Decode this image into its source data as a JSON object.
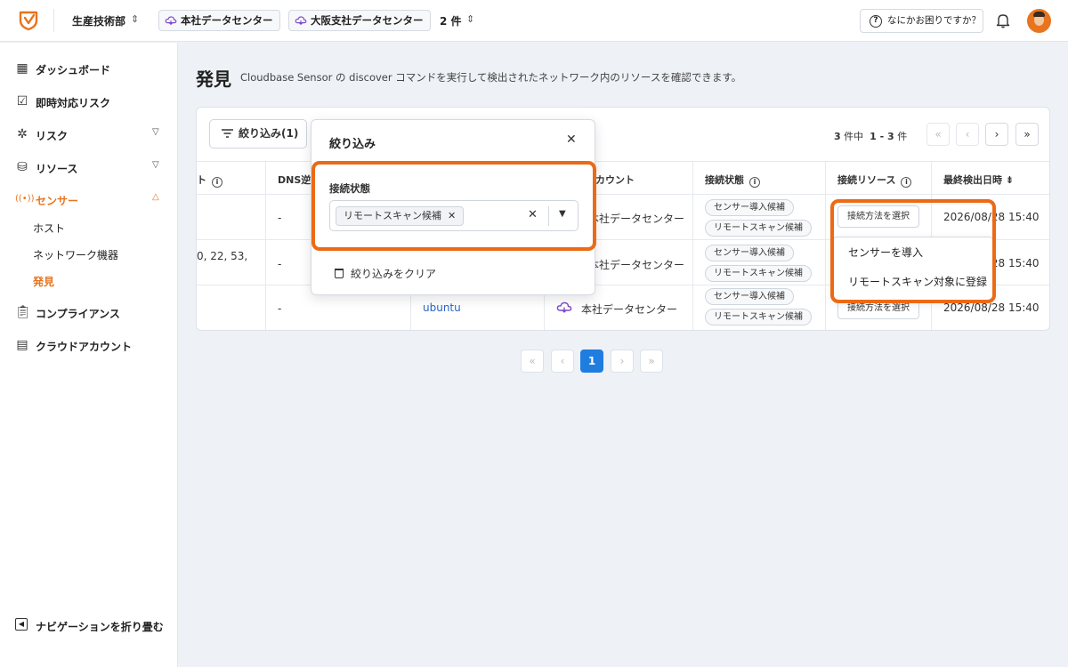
{
  "topbar": {
    "org": "生産技術部",
    "data_centers": [
      "本社データセンター",
      "大阪支社データセンター"
    ],
    "dc_count": "2 件",
    "help": "なにかお困りですか？",
    "colors": {
      "accent": "#e8741e",
      "highlight": "#ec6a15",
      "link": "#2563c9",
      "primary": "#1f7de0"
    }
  },
  "sidebar": {
    "items": [
      {
        "label": "ダッシュボード",
        "icon": "dashboard-icon"
      },
      {
        "label": "即時対応リスク",
        "icon": "urgent-risk-icon"
      },
      {
        "label": "リスク",
        "icon": "bug-icon"
      },
      {
        "label": "リソース",
        "icon": "database-icon"
      },
      {
        "label": "センサー",
        "icon": "sensor-icon"
      },
      {
        "label": "コンプライアンス",
        "icon": "clipboard-icon"
      },
      {
        "label": "クラウドアカウント",
        "icon": "server-icon"
      }
    ],
    "sensor_sub": [
      "ホスト",
      "ネットワーク機器",
      "発見"
    ],
    "collapse": "ナビゲーションを折り畳む"
  },
  "page": {
    "title": "発見",
    "description": "Cloudbase Sensor の discover コマンドを実行して検出されたネットワーク内のリソースを確認できます。"
  },
  "toolbar": {
    "filter_button": "絞り込み(1)",
    "count": "3",
    "count_unit": "件中",
    "range": "1 - 3",
    "range_unit": "件"
  },
  "table": {
    "headers": {
      "ports": "ト",
      "dns": "DNS逆引",
      "account": "アカウント",
      "status": "接続状態",
      "resource": "接続リソース",
      "last_seen": "最終検出日時"
    },
    "rows": [
      {
        "ports": "",
        "dns": "-",
        "host": "",
        "account": "本社データセンター",
        "status": [
          "センサー導入候補",
          "リモートスキャン候補"
        ],
        "action": "接続方法を選択",
        "last_seen": "2026/08/28 15:40"
      },
      {
        "ports": "0, 22, 53,",
        "dns": "-",
        "host": "",
        "account": "本社データセンター",
        "status": [
          "センサー導入候補",
          "リモートスキャン候補"
        ],
        "action": "",
        "last_seen": "2026/08/28 15:40"
      },
      {
        "ports": "",
        "dns": "-",
        "host": "ubuntu",
        "account": "本社データセンター",
        "status": [
          "センサー導入候補",
          "リモートスキャン候補"
        ],
        "action": "接続方法を選択",
        "last_seen": "2026/08/28 15:40"
      }
    ]
  },
  "pagination": {
    "current": "1"
  },
  "filter_popover": {
    "title": "絞り込み",
    "field_label": "接続状態",
    "selected_value": "リモートスキャン候補",
    "clear_label": "絞り込みをクリア"
  },
  "action_menu": {
    "items": [
      "センサーを導入",
      "リモートスキャン対象に登録"
    ]
  }
}
